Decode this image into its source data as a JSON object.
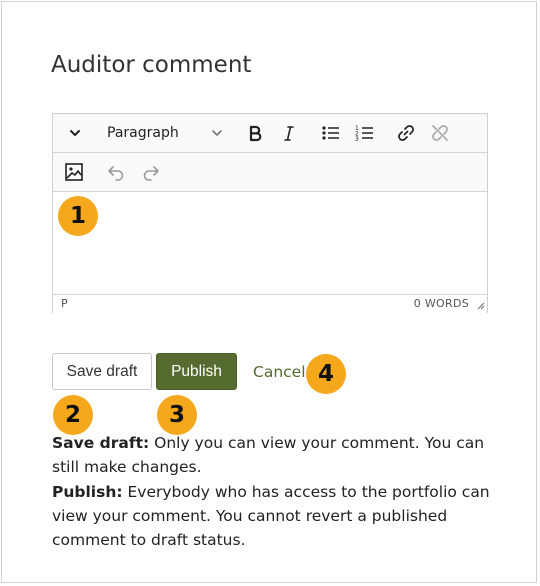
{
  "title": "Auditor comment",
  "toolbar": {
    "block_format": "Paragraph",
    "icons": [
      "chevron-down-icon",
      "bold-icon",
      "italic-icon",
      "bullet-list-icon",
      "numbered-list-icon",
      "link-icon",
      "unlink-icon",
      "image-icon",
      "undo-icon",
      "redo-icon"
    ]
  },
  "editor": {
    "status_path": "P",
    "word_count": "0 WORDS",
    "content": ""
  },
  "badges": {
    "b1": "1",
    "b2": "2",
    "b3": "3",
    "b4": "4"
  },
  "buttons": {
    "save_draft": "Save draft",
    "publish": "Publish",
    "cancel": "Cancel"
  },
  "help": {
    "draft_label": "Save draft:",
    "draft_text": " Only you can view your comment. You can still make changes.",
    "publish_label": "Publish:",
    "publish_text": " Everybody who has access to the portfolio can view your comment. You cannot revert a published comment to draft status."
  },
  "colors": {
    "accent": "#556b2f",
    "badge": "#f5a81c"
  }
}
